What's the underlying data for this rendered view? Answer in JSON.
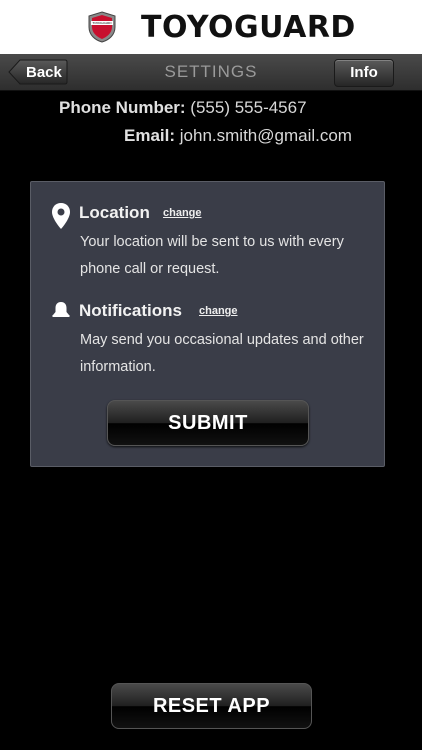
{
  "header": {
    "logo_text": "TOYOGUARD",
    "brand": "TOYOGUARD"
  },
  "navbar": {
    "back_label": "Back",
    "title": "SETTINGS",
    "info_label": "Info"
  },
  "contact": {
    "phone_label": "Phone Number:",
    "phone_value": "(555) 555-4567",
    "email_label": "Email:",
    "email_value": "john.smith@gmail.com"
  },
  "location": {
    "title": "Location",
    "change_label": "change",
    "description": "Your location will be sent to us with every phone call or request."
  },
  "notifications": {
    "title": "Notifications",
    "change_label": "change",
    "description": "May send you occasional updates and other information."
  },
  "submit_label": "SUBMIT",
  "reset_label": "RESET APP",
  "colors": {
    "background": "#000000",
    "panel": "#3a3d48",
    "navbar": "#3a3a3a",
    "logo_red": "#c8102e"
  },
  "icons": {
    "logo": "toyoguard-shield-logo",
    "location": "location-pin-icon",
    "notifications": "bell-icon",
    "back": "back-arrow-button"
  }
}
